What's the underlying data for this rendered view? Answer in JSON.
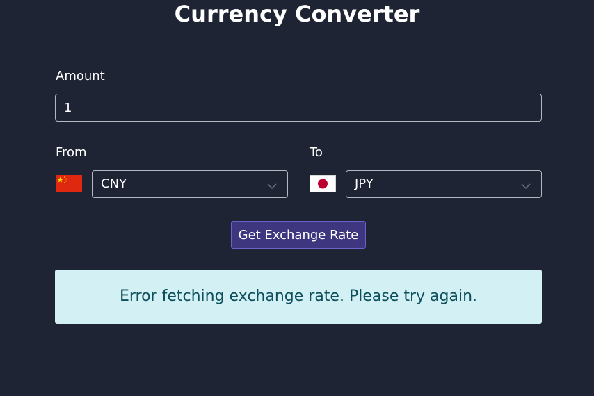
{
  "app": {
    "title": "Currency Converter"
  },
  "amount": {
    "label": "Amount",
    "value": "1"
  },
  "from": {
    "label": "From",
    "currency": "CNY",
    "flag_icon": "china-flag-icon"
  },
  "to": {
    "label": "To",
    "currency": "JPY",
    "flag_icon": "japan-flag-icon"
  },
  "actions": {
    "convert_label": "Get Exchange Rate"
  },
  "status": {
    "message": "Error fetching exchange rate. Please try again."
  },
  "colors": {
    "background": "#1e2433",
    "button": "#3e3780",
    "alert_background": "#d3f0f5",
    "alert_text": "#0d4f5c",
    "china_flag_red": "#de2910",
    "china_flag_yellow": "#ffde00",
    "japan_flag_red": "#bc002d"
  }
}
